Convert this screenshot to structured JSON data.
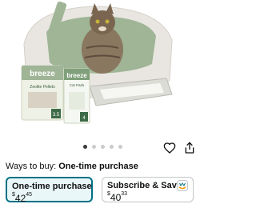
{
  "product": {
    "image_alt": "Cat in litter box with breeze pellets and pads",
    "brand_name": "breeze",
    "pellets_label": "Zeolite Pellets",
    "pellets_count": "3.5",
    "pads_label": "Cat Pads",
    "pads_count": "4"
  },
  "carousel": {
    "total": 5,
    "active_index": 0
  },
  "purchase": {
    "ways_label": "Ways to buy:",
    "ways_value": "One-time purchase",
    "options": [
      {
        "title": "One-time purchase",
        "currency": "$",
        "whole": "42",
        "fraction": "45",
        "selected": true
      },
      {
        "title": "Subscribe & Save",
        "currency": "$",
        "whole": "40",
        "fraction": "33",
        "selected": false
      }
    ]
  },
  "colors": {
    "accent": "#007185",
    "selected_bg": "#eaf7f9",
    "border": "#c2c6c6"
  }
}
